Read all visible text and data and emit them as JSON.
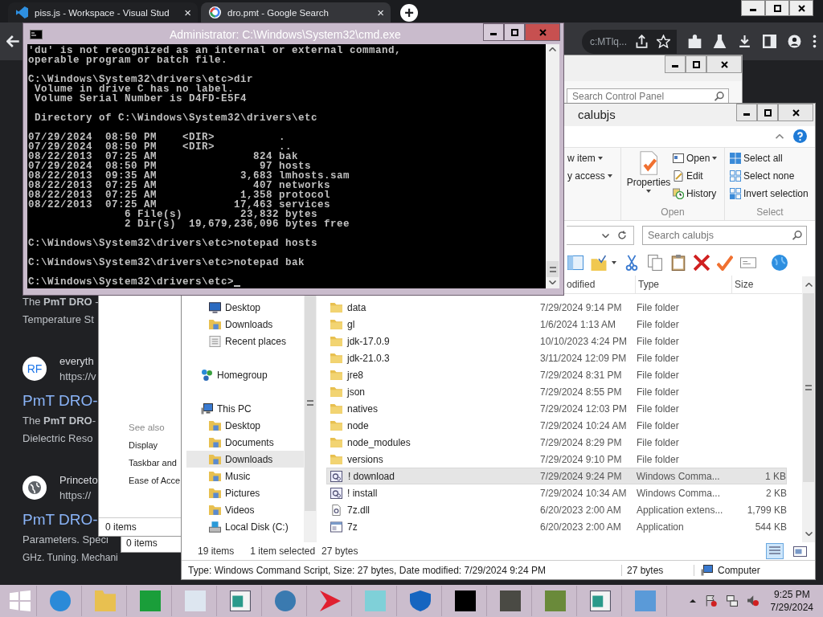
{
  "browser": {
    "tabs": [
      {
        "title": "piss.js - Workspace - Visual Stud",
        "close": "×",
        "selected": false
      },
      {
        "title": "dro.pmt - Google Search",
        "close": "×",
        "selected": true
      }
    ],
    "new_tab": "+",
    "address_fragment": "c:MTlq...",
    "results": [
      {
        "kind": "snippet",
        "lines": [
          "The **PmT DRO** -",
          "Temperature St"
        ]
      },
      {
        "kind": "source",
        "avatar": "RF",
        "name": "everyth",
        "url": "https://v"
      },
      {
        "kind": "title",
        "text": "PmT DRO-"
      },
      {
        "kind": "snippet",
        "lines": [
          "The **PmT DRO**-",
          "Dielectric Reso"
        ]
      },
      {
        "kind": "source",
        "name": "Princeto",
        "url": "https://"
      },
      {
        "kind": "title",
        "text": "PmT DRO-"
      },
      {
        "kind": "snippet",
        "lines": [
          "Parameters. Speci",
          "GHz. Tuning. Mechani"
        ]
      }
    ]
  },
  "control_panel": {
    "search_placeholder": "Search Control Panel",
    "see_also": "See also",
    "links": [
      "Display",
      "Taskbar and",
      "Ease of Acce"
    ],
    "status": "0 items"
  },
  "control_panel_2": {
    "status": "0 items"
  },
  "cmd": {
    "title": "Administrator: C:\\Windows\\System32\\cmd.exe",
    "blocks": [
      [
        "'du' is not recognized as an internal or external command,",
        "operable program or batch file."
      ],
      [
        "C:\\Windows\\System32\\drivers\\etc>dir",
        " Volume in drive C has no label.",
        " Volume Serial Number is D4FD-E5F4"
      ],
      [
        " Directory of C:\\Windows\\System32\\drivers\\etc"
      ],
      [
        "07/29/2024  08:50 PM    <DIR>          .",
        "07/29/2024  08:50 PM    <DIR>          ..",
        "08/22/2013  07:25 AM               824 bak",
        "07/29/2024  08:50 PM                97 hosts",
        "08/22/2013  09:35 AM             3,683 lmhosts.sam",
        "08/22/2013  07:25 AM               407 networks",
        "08/22/2013  07:25 AM             1,358 protocol",
        "08/22/2013  07:25 AM            17,463 services",
        "               6 File(s)         23,832 bytes",
        "               2 Dir(s)  19,679,236,096 bytes free"
      ],
      [
        "C:\\Windows\\System32\\drivers\\etc>notepad hosts"
      ],
      [
        "C:\\Windows\\System32\\drivers\\etc>notepad bak"
      ],
      [
        "C:\\Windows\\System32\\drivers\\etc>"
      ]
    ]
  },
  "explorer": {
    "title": "calubjs",
    "ribbon": {
      "new_items": [
        "w item",
        "y access"
      ],
      "properties": "Properties",
      "open_items": [
        "Open",
        "Edit",
        "History"
      ],
      "open_label": "Open",
      "select_items": [
        "Select all",
        "Select none",
        "Invert selection"
      ],
      "select_label": "Select"
    },
    "search_placeholder": "Search calubjs",
    "columns": [
      "odified",
      "Type",
      "Size"
    ],
    "nav_pane": [
      {
        "children": [
          {
            "label": "Desktop",
            "kind": "desktop",
            "selected": false
          },
          {
            "label": "Downloads",
            "kind": "folder",
            "selected": false
          },
          {
            "label": "Recent places",
            "kind": "recent",
            "selected": false
          }
        ]
      },
      {
        "label": "Homegroup",
        "kind": "homegroup",
        "selected": false
      },
      {
        "label": "This PC",
        "kind": "computer",
        "selected": false,
        "children": [
          {
            "label": "Desktop",
            "kind": "folder",
            "selected": false
          },
          {
            "label": "Documents",
            "kind": "folder",
            "selected": false
          },
          {
            "label": "Downloads",
            "kind": "folder",
            "selected": true
          },
          {
            "label": "Music",
            "kind": "folder",
            "selected": false
          },
          {
            "label": "Pictures",
            "kind": "folder",
            "selected": false
          },
          {
            "label": "Videos",
            "kind": "folder",
            "selected": false
          },
          {
            "label": "Local Disk (C:)",
            "kind": "drive",
            "selected": false
          }
        ]
      }
    ],
    "files": [
      {
        "name": "data",
        "date": "7/29/2024 9:14 PM",
        "type": "File folder",
        "kind": "folder",
        "selected": false
      },
      {
        "name": "gl",
        "date": "1/6/2024 1:13 AM",
        "type": "File folder",
        "kind": "folder",
        "selected": false
      },
      {
        "name": "jdk-17.0.9",
        "date": "10/10/2023 4:24 PM",
        "type": "File folder",
        "kind": "folder",
        "selected": false
      },
      {
        "name": "jdk-21.0.3",
        "date": "3/11/2024 12:09 PM",
        "type": "File folder",
        "kind": "folder",
        "selected": false
      },
      {
        "name": "jre8",
        "date": "7/29/2024 8:31 PM",
        "type": "File folder",
        "kind": "folder",
        "selected": false
      },
      {
        "name": "json",
        "date": "7/29/2024 8:55 PM",
        "type": "File folder",
        "kind": "folder",
        "selected": false
      },
      {
        "name": "natives",
        "date": "7/29/2024 12:03 PM",
        "type": "File folder",
        "kind": "folder",
        "selected": false
      },
      {
        "name": "node",
        "date": "7/29/2024 10:24 AM",
        "type": "File folder",
        "kind": "folder",
        "selected": false
      },
      {
        "name": "node_modules",
        "date": "7/29/2024 8:29 PM",
        "type": "File folder",
        "kind": "folder",
        "selected": false
      },
      {
        "name": "versions",
        "date": "7/29/2024 9:10 PM",
        "type": "File folder",
        "kind": "folder",
        "selected": false
      },
      {
        "name": "! download",
        "date": "7/29/2024 9:24 PM",
        "type": "Windows Comma...",
        "size": "1 KB",
        "kind": "script",
        "selected": true
      },
      {
        "name": "! install",
        "date": "7/29/2024 10:34 AM",
        "type": "Windows Comma...",
        "size": "2 KB",
        "kind": "script",
        "selected": false
      },
      {
        "name": "7z.dll",
        "date": "6/20/2023 2:00 AM",
        "type": "Application extens...",
        "size": "1,799 KB",
        "kind": "library",
        "selected": false
      },
      {
        "name": "7z",
        "date": "6/20/2023 2:00 AM",
        "type": "Application",
        "size": "544 KB",
        "kind": "application",
        "selected": false
      }
    ],
    "status": {
      "count": "19 items",
      "selection": "1 item selected",
      "size": "27 bytes"
    },
    "details": {
      "text": "Type: Windows Command Script, Size: 27 bytes, Date modified: 7/29/2024 9:24 PM",
      "size": "27 bytes",
      "location": "Computer"
    }
  },
  "taskbar": {
    "time": "9:25 PM",
    "date": "7/29/2024"
  }
}
